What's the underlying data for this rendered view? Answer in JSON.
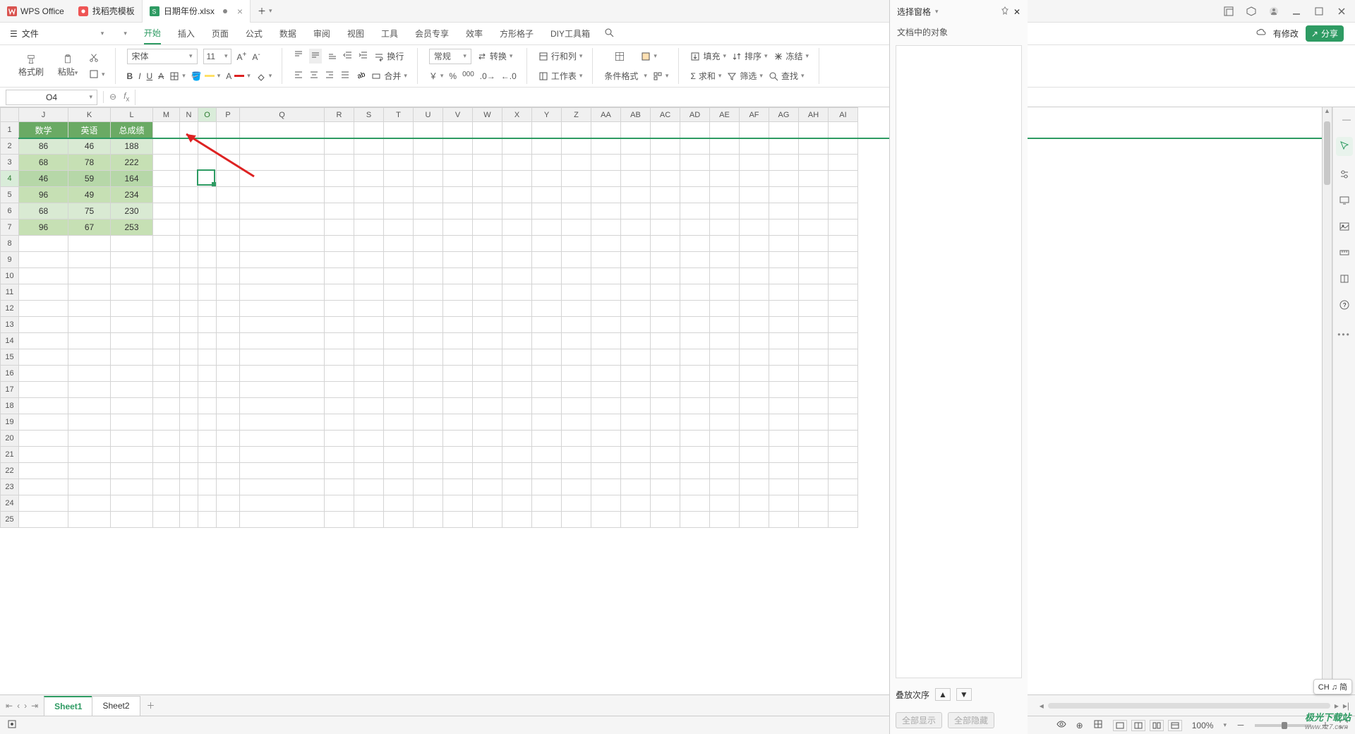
{
  "title_tabs": {
    "app": "WPS Office",
    "template": "找稻壳模板",
    "file": "日期年份.xlsx"
  },
  "menu": {
    "file": "文件",
    "tabs": [
      "开始",
      "插入",
      "页面",
      "公式",
      "数据",
      "审阅",
      "视图",
      "工具",
      "会员专享",
      "效率",
      "方形格子",
      "DIY工具箱"
    ],
    "active": "开始",
    "has_edit": "有修改",
    "share": "分享"
  },
  "ribbon": {
    "format_painter": "格式刷",
    "paste": "粘贴",
    "font_name": "宋体",
    "font_size": "11",
    "wrap": "换行",
    "merge": "合并",
    "number_format": "常规",
    "convert": "转换",
    "rowcol": "行和列",
    "worksheet": "工作表",
    "cond_format": "条件格式",
    "fill": "填充",
    "sort": "排序",
    "freeze": "冻结",
    "sum": "求和",
    "filter": "筛选",
    "find": "查找"
  },
  "namebox": "O4",
  "columns": [
    "J",
    "K",
    "L",
    "M",
    "N",
    "O",
    "P",
    "Q",
    "R",
    "S",
    "T",
    "U",
    "V",
    "W",
    "X",
    "Y",
    "Z",
    "AA",
    "AB",
    "AC",
    "AD",
    "AE",
    "AF",
    "AG",
    "AH",
    "AI"
  ],
  "col_widths": {
    "J": 70,
    "K": 60,
    "L": 60,
    "M": 38,
    "N": 26,
    "O": 26,
    "P": 33,
    "Q": 120,
    "default": 42
  },
  "visible_rows": 25,
  "selected": {
    "col": "O",
    "row": 4
  },
  "headers": [
    "数学",
    "英语",
    "总成绩"
  ],
  "data_rows": [
    [
      86,
      46,
      188
    ],
    [
      68,
      78,
      222
    ],
    [
      46,
      59,
      164
    ],
    [
      96,
      49,
      234
    ],
    [
      68,
      75,
      230
    ],
    [
      96,
      67,
      253
    ]
  ],
  "pane": {
    "title": "选择窗格",
    "subtitle": "文档中的对象",
    "order": "叠放次序",
    "show_all": "全部显示",
    "hide_all": "全部隐藏"
  },
  "sheets": {
    "tabs": [
      "Sheet1",
      "Sheet2"
    ],
    "active": "Sheet1"
  },
  "status": {
    "zoom": "100%"
  },
  "ime": "CH ♫ 简",
  "watermark": {
    "brand": "极光下载站",
    "url": "www.xz7.com"
  }
}
